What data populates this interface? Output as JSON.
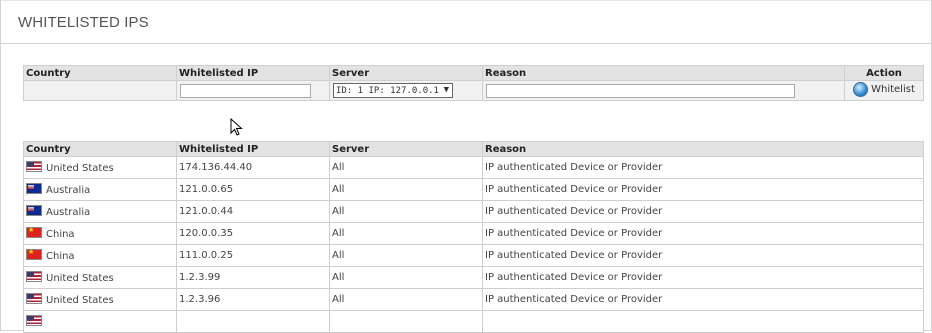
{
  "heading": "WHITELISTED IPS",
  "form": {
    "headers": {
      "country": "Country",
      "ip": "Whitelisted IP",
      "server": "Server",
      "reason": "Reason",
      "action": "Action"
    },
    "ip_value": "",
    "server_selected": "ID: 1 IP: 127.0.0.1",
    "reason_value": "",
    "whitelist_label": "Whitelist"
  },
  "list": {
    "headers": {
      "country": "Country",
      "ip": "Whitelisted IP",
      "server": "Server",
      "reason": "Reason"
    },
    "rows": [
      {
        "flag": "us",
        "country": "United States",
        "ip": "174.136.44.40",
        "server": "All",
        "reason": "IP authenticated Device or Provider"
      },
      {
        "flag": "au",
        "country": "Australia",
        "ip": "121.0.0.65",
        "server": "All",
        "reason": "IP authenticated Device or Provider"
      },
      {
        "flag": "au",
        "country": "Australia",
        "ip": "121.0.0.44",
        "server": "All",
        "reason": "IP authenticated Device or Provider"
      },
      {
        "flag": "cn",
        "country": "China",
        "ip": "120.0.0.35",
        "server": "All",
        "reason": "IP authenticated Device or Provider"
      },
      {
        "flag": "cn",
        "country": "China",
        "ip": "111.0.0.25",
        "server": "All",
        "reason": "IP authenticated Device or Provider"
      },
      {
        "flag": "us",
        "country": "United States",
        "ip": "1.2.3.99",
        "server": "All",
        "reason": "IP authenticated Device or Provider"
      },
      {
        "flag": "us",
        "country": "United States",
        "ip": "1.2.3.96",
        "server": "All",
        "reason": "IP authenticated Device or Provider"
      },
      {
        "flag": "us",
        "country": "",
        "ip": "",
        "server": "",
        "reason": ""
      }
    ]
  }
}
